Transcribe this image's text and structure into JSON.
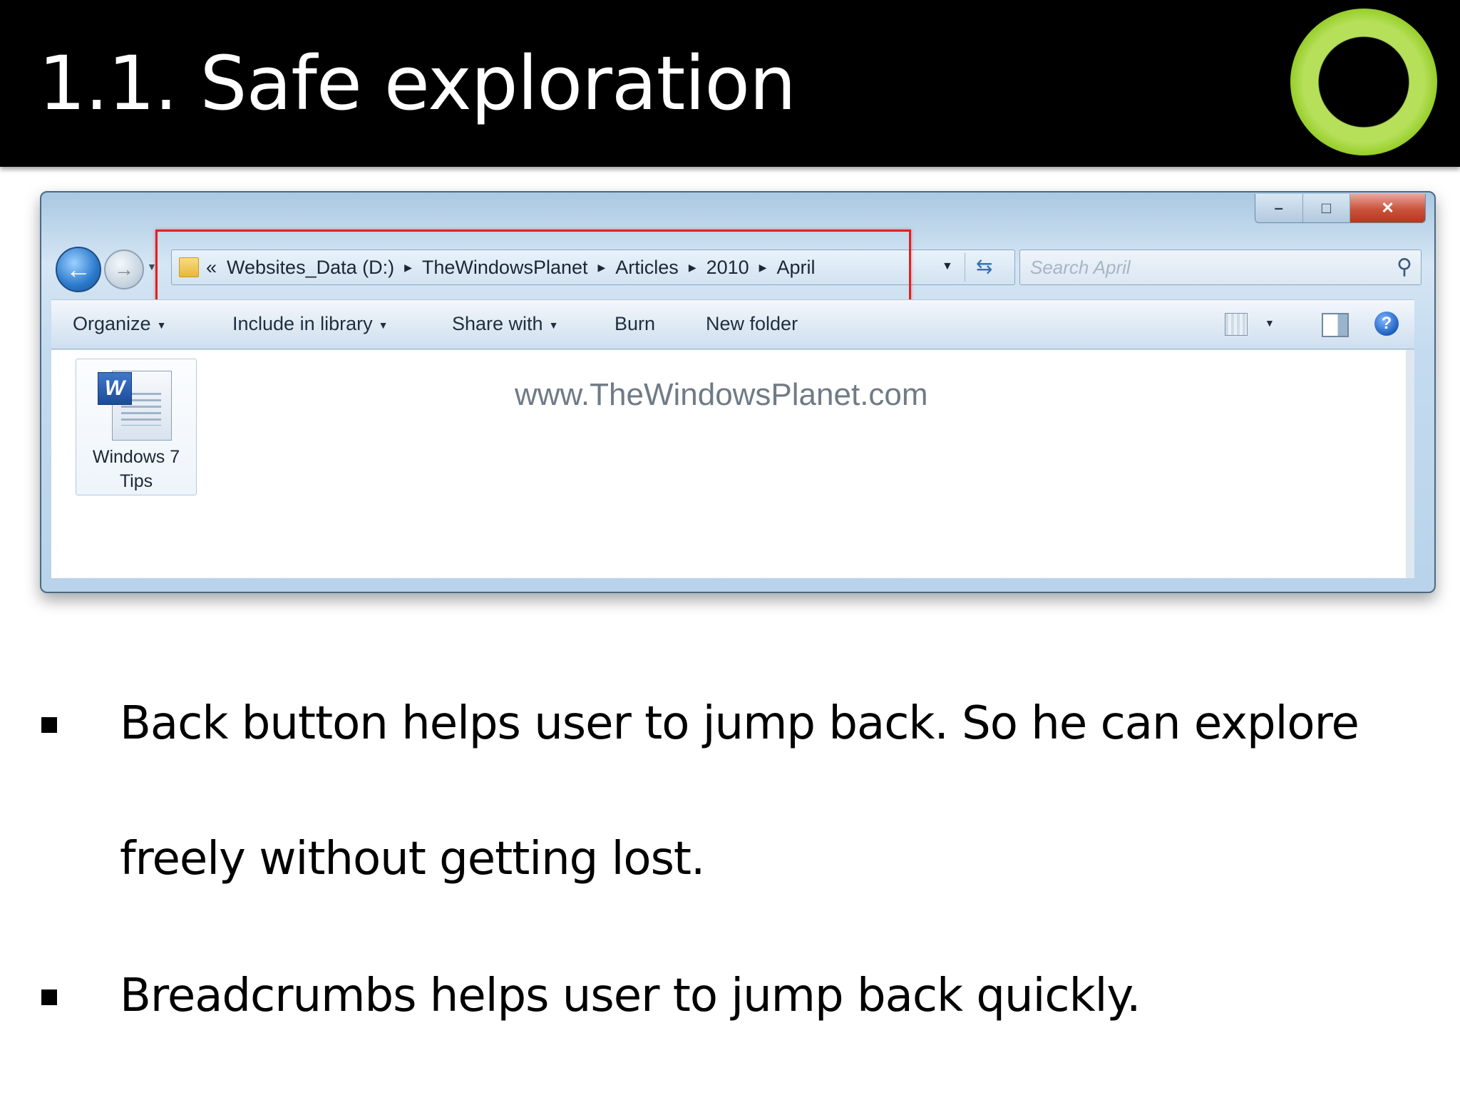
{
  "slide": {
    "title": "1.1. Safe exploration"
  },
  "explorer": {
    "breadcrumb": {
      "overflow": "«",
      "items": [
        "Websites_Data (D:)",
        "TheWindowsPlanet",
        "Articles",
        "2010",
        "April"
      ]
    },
    "search": {
      "placeholder": "Search April"
    },
    "toolbar": {
      "organize": "Organize",
      "include_in_library": "Include in library",
      "share_with": "Share with",
      "burn": "Burn",
      "new_folder": "New folder"
    },
    "files": [
      {
        "name_line1": "Windows 7",
        "name_line2": "Tips",
        "icon": "word-document-icon"
      }
    ],
    "watermark": "www.TheWindowsPlanet.com",
    "window_controls": {
      "minimize": "–",
      "maximize": "□",
      "close": "✕"
    },
    "nav": {
      "back": "⮌",
      "forward": "➔"
    }
  },
  "bullets": [
    {
      "line1": "Back button helps user to jump back. So he can explore",
      "line2": "freely without getting lost."
    },
    {
      "line1": "Breadcrumbs helps user to jump back quickly."
    }
  ],
  "colors": {
    "title_bg": "#000000",
    "logo_ring": "#98cf2c",
    "highlight": "#e0211f"
  }
}
